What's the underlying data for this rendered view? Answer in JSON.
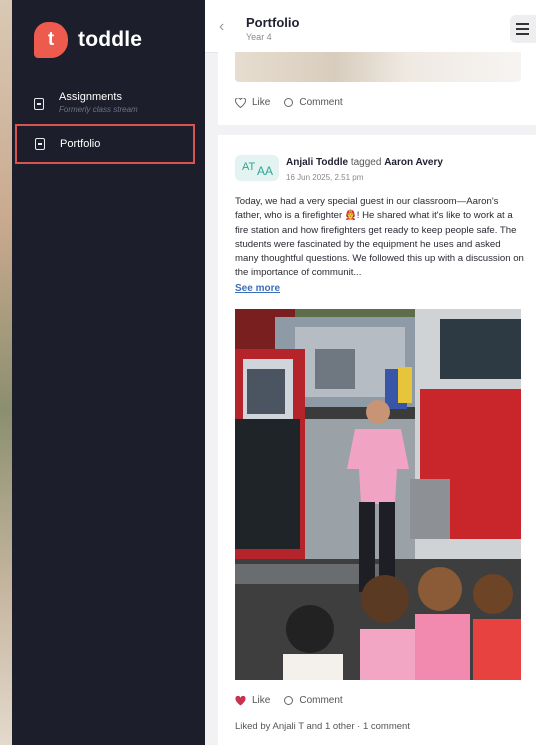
{
  "app": {
    "logo_letter": "t",
    "name": "toddle"
  },
  "sidebar": {
    "items": [
      {
        "label": "Assignments",
        "sublabel": "Formerly class stream"
      },
      {
        "label": "Portfolio",
        "sublabel": ""
      }
    ]
  },
  "header": {
    "title": "Portfolio",
    "subtitle": "Year 4",
    "back_glyph": "‹"
  },
  "prev_post": {
    "like_label": "Like",
    "comment_label": "Comment"
  },
  "post": {
    "avatar_initials_1": "AT",
    "avatar_initials_2": "AA",
    "author": "Anjali Toddle",
    "tagged_word": "tagged",
    "tagged_person": "Aaron Avery",
    "date": "16 Jun 2025, 2.51 pm",
    "text": "Today, we had a very special guest in our classroom—Aaron's father, who is a firefighter 🧑‍🚒! He shared what it's like to work at a fire station and how firefighters get ready to keep people safe. The students were fascinated by the equipment he uses and asked many thoughtful questions. We followed this up with a discussion on the importance of communit...",
    "see_more": "See more",
    "like_label": "Like",
    "comment_label": "Comment",
    "likes_summary": "Liked by Anjali T and 1 other · 1 comment"
  },
  "colors": {
    "sidebar_bg": "#1c1f2b",
    "brand": "#ec5b4e",
    "highlight_border": "#d9534f",
    "liked_heart": "#c8334f"
  }
}
